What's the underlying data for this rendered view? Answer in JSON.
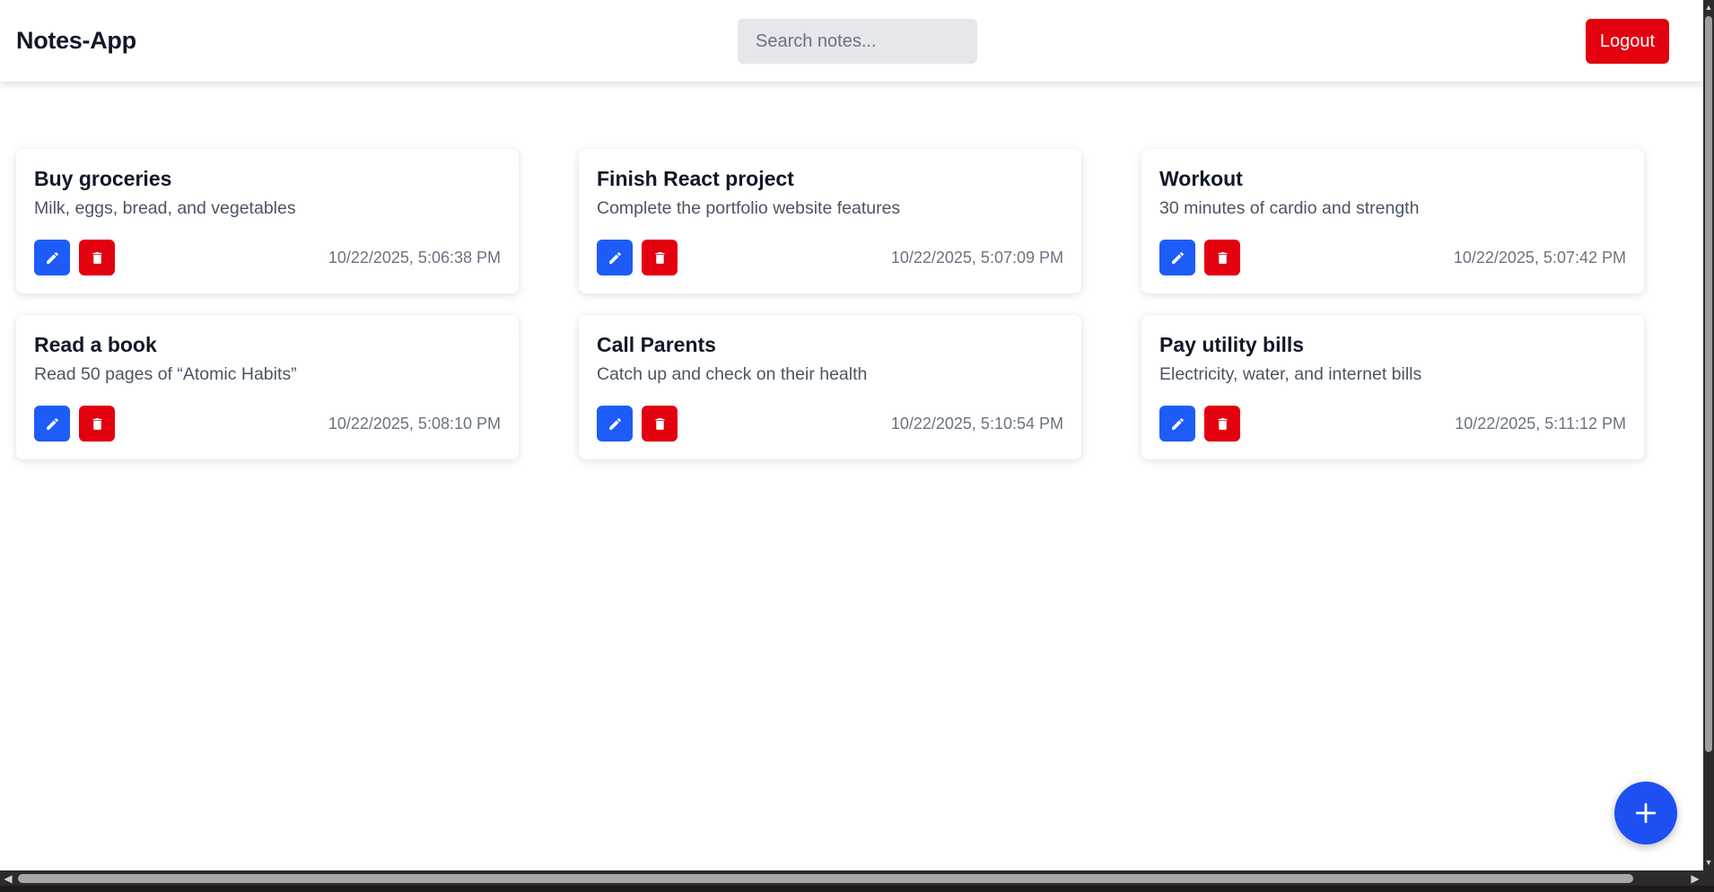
{
  "header": {
    "brand": "Notes-App",
    "search_placeholder": "Search notes...",
    "logout_label": "Logout"
  },
  "notes": [
    {
      "title": "Buy groceries",
      "body": "Milk, eggs, bread, and vegetables",
      "date": "10/22/2025, 5:06:38 PM"
    },
    {
      "title": "Finish React project",
      "body": "Complete the portfolio website features",
      "date": "10/22/2025, 5:07:09 PM"
    },
    {
      "title": "Workout",
      "body": "30 minutes of cardio and strength",
      "date": "10/22/2025, 5:07:42 PM"
    },
    {
      "title": "Read a book",
      "body": "Read 50 pages of “Atomic Habits”",
      "date": "10/22/2025, 5:08:10 PM"
    },
    {
      "title": "Call Parents",
      "body": "Catch up and check on their health",
      "date": "10/22/2025, 5:10:54 PM"
    },
    {
      "title": "Pay utility bills",
      "body": "Electricity, water, and internet bills",
      "date": "10/22/2025, 5:11:12 PM"
    }
  ],
  "icons": {
    "edit": "pencil-icon",
    "delete": "trash-icon",
    "add": "plus-icon"
  },
  "colors": {
    "primary": "#1d5cf7",
    "danger": "#e3000f",
    "fab": "#1d4ff2"
  }
}
